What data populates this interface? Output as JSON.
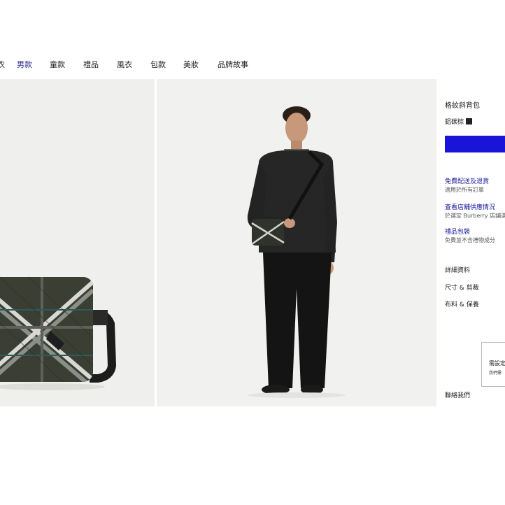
{
  "nav": {
    "items": [
      {
        "label": "男款",
        "active": true
      },
      {
        "label": "童款",
        "active": false
      },
      {
        "label": "禮品",
        "active": false
      },
      {
        "label": "風衣",
        "active": false
      },
      {
        "label": "包款",
        "active": false
      },
      {
        "label": "美妝",
        "active": false
      },
      {
        "label": "品牌故事",
        "active": false
      }
    ]
  },
  "product": {
    "title": "格紋斜背包",
    "color_label": "鋁碳棕",
    "swatch_color": "#222222",
    "buy_button_color": "#1a14d8"
  },
  "links": [
    {
      "title": "免費配送及退貨",
      "subtitle": "適用於所有訂單"
    },
    {
      "title": "查看店舖供應情況",
      "subtitle": "於選定 Burberry 店舖選"
    },
    {
      "title": "禮品包裝",
      "subtitle": "免費並不含禮物成分"
    }
  ],
  "accordions": [
    "詳細資料",
    "尺寸 & 剪裁",
    "布料 & 保養"
  ],
  "toast": {
    "line1": "需設定",
    "line2": "我們需"
  },
  "contact_label": "聯絡我們"
}
